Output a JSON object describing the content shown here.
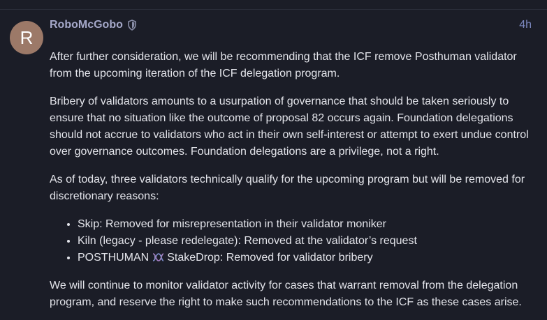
{
  "post": {
    "author": {
      "avatar_letter": "R",
      "username": "RoboMcGobo",
      "badge_icon": "shield-icon"
    },
    "date": "4h",
    "paragraphs": [
      "After further consideration, we will be recommending that the ICF remove Posthuman validator from the upcoming iteration of the ICF delegation program.",
      "Bribery of validators amounts to a usurpation of governance that should be taken seriously to ensure that no situation like the outcome of proposal 82 occurs again. Foundation delegations should not accrue to validators who act in their own self-interest or attempt to exert undue control over governance outcomes. Foundation delegations are a privilege, not a right.",
      "As of today, three validators technically qualify for the upcoming program but will be removed for discretionary reasons:"
    ],
    "list_items": [
      "Skip: Removed for misrepresentation in their validator moniker",
      "Kiln (legacy - please redelegate): Removed at the validator’s request"
    ],
    "list_item_posthuman": {
      "prefix": "POSTHUMAN",
      "icon": "dna-icon",
      "suffix": "StakeDrop: Removed for validator bribery"
    },
    "closing_paragraph": "We will continue to monitor validator activity for cases that warrant removal from the delegation program, and reserve the right to make such recommendations to the ICF as these cases arise."
  },
  "colors": {
    "background": "#1b1d27",
    "username": "#a5a8c9",
    "date": "#7c88bf",
    "avatar": "#9c7968",
    "text": "#e3e4ea"
  }
}
